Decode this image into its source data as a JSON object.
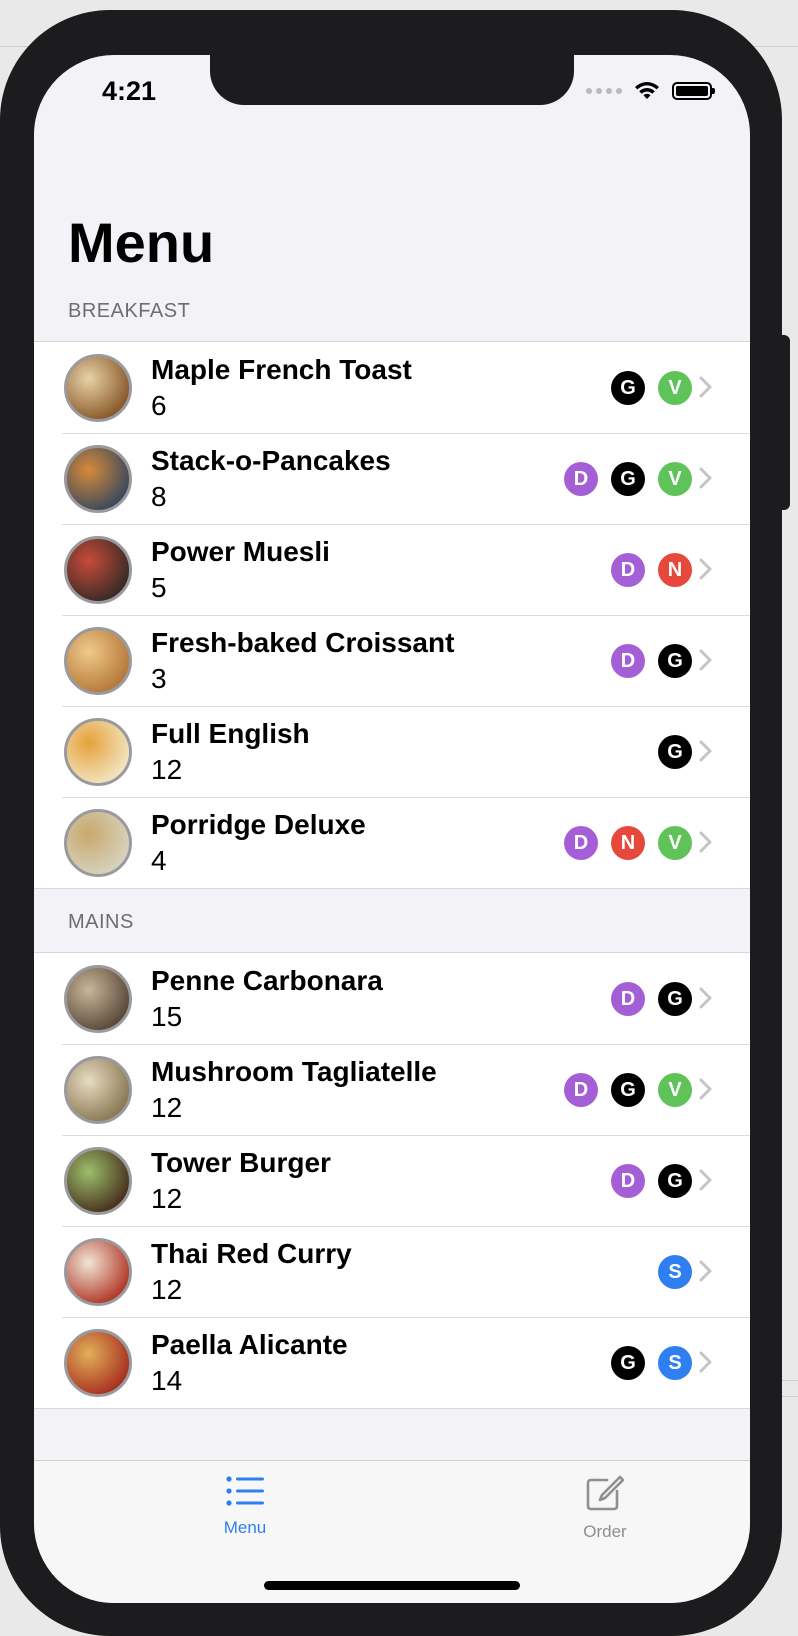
{
  "status_bar": {
    "time": "4:21"
  },
  "title": "Menu",
  "sections": [
    {
      "header": "BREAKFAST",
      "items": [
        {
          "name": "Maple French Toast",
          "price": "6",
          "tags": [
            "G",
            "V"
          ]
        },
        {
          "name": "Stack-o-Pancakes",
          "price": "8",
          "tags": [
            "D",
            "G",
            "V"
          ]
        },
        {
          "name": "Power Muesli",
          "price": "5",
          "tags": [
            "D",
            "N"
          ]
        },
        {
          "name": "Fresh-baked Croissant",
          "price": "3",
          "tags": [
            "D",
            "G"
          ]
        },
        {
          "name": "Full English",
          "price": "12",
          "tags": [
            "G"
          ]
        },
        {
          "name": "Porridge Deluxe",
          "price": "4",
          "tags": [
            "D",
            "N",
            "V"
          ]
        }
      ]
    },
    {
      "header": "MAINS",
      "items": [
        {
          "name": "Penne Carbonara",
          "price": "15",
          "tags": [
            "D",
            "G"
          ]
        },
        {
          "name": "Mushroom Tagliatelle",
          "price": "12",
          "tags": [
            "D",
            "G",
            "V"
          ]
        },
        {
          "name": "Tower Burger",
          "price": "12",
          "tags": [
            "D",
            "G"
          ]
        },
        {
          "name": "Thai Red Curry",
          "price": "12",
          "tags": [
            "S"
          ]
        },
        {
          "name": "Paella Alicante",
          "price": "14",
          "tags": [
            "G",
            "S"
          ]
        }
      ]
    }
  ],
  "tag_colors": {
    "D": "#a55fd6",
    "G": "#000000",
    "V": "#5fc35a",
    "N": "#e6493b",
    "S": "#2f7ff0"
  },
  "tab_bar": {
    "menu_label": "Menu",
    "order_label": "Order",
    "active_color": "#2f7ff0",
    "inactive_color": "#8e8e93"
  }
}
